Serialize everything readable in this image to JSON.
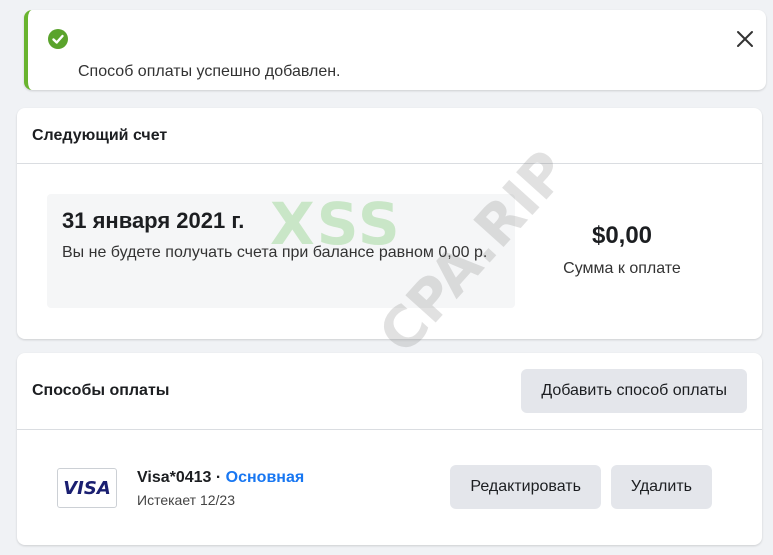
{
  "toast": {
    "message": "Способ оплаты успешно добавлен.",
    "icons": {
      "status": "check-circle-icon",
      "close": "close-icon"
    },
    "accent_color": "#69b42e"
  },
  "next_bill": {
    "heading": "Следующий счет",
    "date": "31 января 2021 г.",
    "note": "Вы не будете получать счета при балансе равном 0,00 р.",
    "amount": "$0,00",
    "amount_label": "Сумма к оплате"
  },
  "payment_methods": {
    "heading": "Способы оплаты",
    "add_button": "Добавить способ оплаты",
    "items": [
      {
        "brand": "VISA",
        "name": "Visa*0413",
        "separator": " · ",
        "status": "Основная",
        "expires": "Истекает 12/23",
        "edit_label": "Редактировать",
        "delete_label": "Удалить"
      }
    ]
  },
  "watermark": {
    "text_primary": "XSS",
    "text_secondary": "CPA.RIP"
  }
}
